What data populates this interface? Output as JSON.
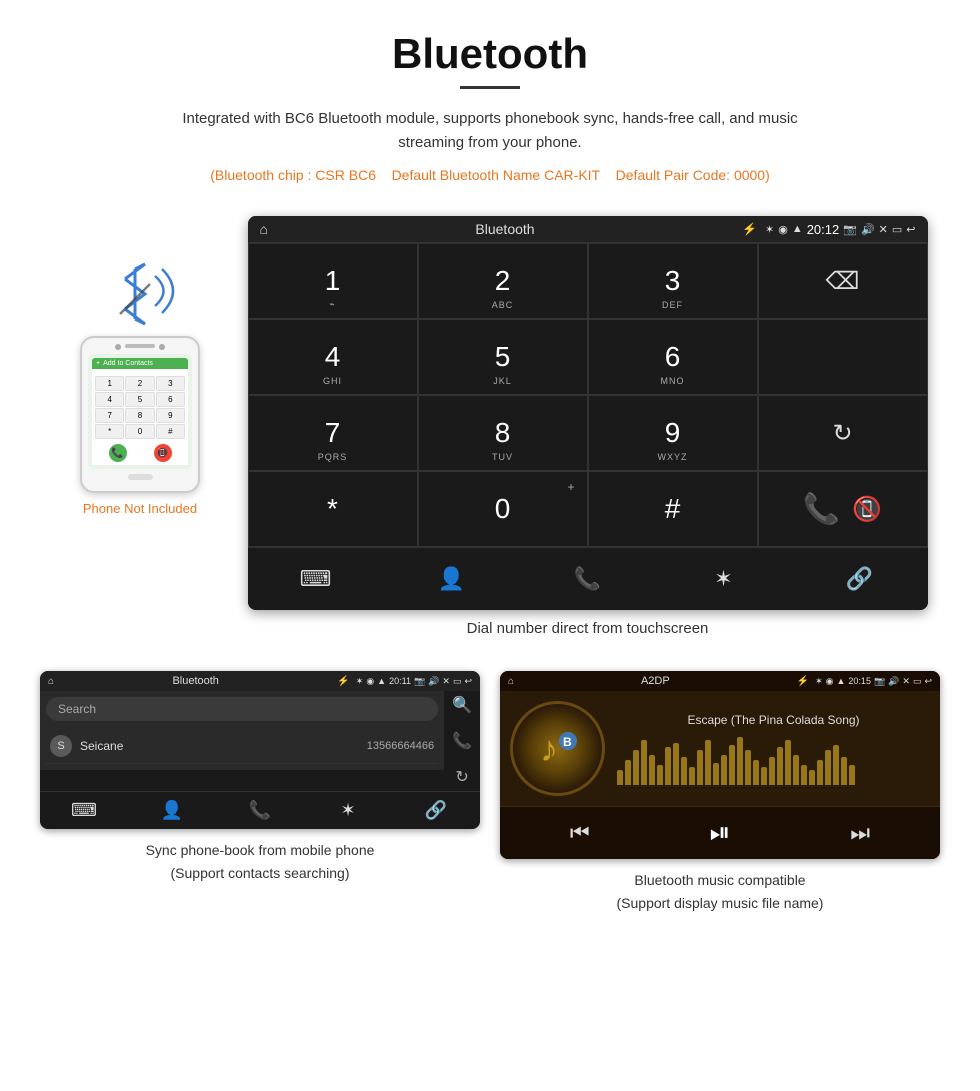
{
  "header": {
    "title": "Bluetooth",
    "description": "Integrated with BC6 Bluetooth module, supports phonebook sync, hands-free call, and music streaming from your phone.",
    "info_line1": "(Bluetooth chip : CSR BC6",
    "info_line2": "Default Bluetooth Name CAR-KIT",
    "info_line3": "Default Pair Code: 0000)",
    "phone_not_included": "Phone Not Included"
  },
  "dialer_screen": {
    "title": "Bluetooth",
    "time": "20:12",
    "keys": [
      {
        "num": "1",
        "sub": ""
      },
      {
        "num": "2",
        "sub": "ABC"
      },
      {
        "num": "3",
        "sub": "DEF"
      },
      {
        "num": "4",
        "sub": "GHI"
      },
      {
        "num": "5",
        "sub": "JKL"
      },
      {
        "num": "6",
        "sub": "MNO"
      },
      {
        "num": "7",
        "sub": "PQRS"
      },
      {
        "num": "8",
        "sub": "TUV"
      },
      {
        "num": "9",
        "sub": "WXYZ"
      },
      {
        "num": "*",
        "sub": ""
      },
      {
        "num": "0",
        "sub": "+"
      },
      {
        "num": "#",
        "sub": ""
      }
    ],
    "caption": "Dial number direct from touchscreen"
  },
  "phonebook_screen": {
    "title": "Bluetooth",
    "time": "20:11",
    "search_placeholder": "Search",
    "contact_initial": "S",
    "contact_name": "Seicane",
    "contact_number": "13566664466",
    "caption_line1": "Sync phone-book from mobile phone",
    "caption_line2": "(Support contacts searching)"
  },
  "music_screen": {
    "title": "A2DP",
    "time": "20:15",
    "track_name": "Escape (The Pina Colada Song)",
    "wave_heights": [
      15,
      25,
      35,
      45,
      30,
      20,
      38,
      42,
      28,
      18,
      35,
      45,
      22,
      30,
      40,
      48,
      35,
      25,
      18,
      28,
      38,
      45,
      30,
      20,
      15,
      25,
      35,
      40,
      28,
      20
    ],
    "caption_line1": "Bluetooth music compatible",
    "caption_line2": "(Support display music file name)"
  },
  "icons": {
    "home": "⌂",
    "back": "↩",
    "bluetooth": "✶",
    "phone_call": "📞",
    "end_call": "📵",
    "contacts": "👤",
    "dialer": "⌨",
    "search": "🔍",
    "reload": "↻",
    "backspace": "⌫",
    "link": "🔗",
    "prev": "⏮",
    "play_pause": "⏯",
    "next": "⏭",
    "usb": "⚡",
    "camera": "📷",
    "volume": "🔊",
    "close": "✕",
    "window": "▭",
    "signal": "▲",
    "wifi": "▲",
    "battery": "▮",
    "location": "●"
  },
  "colors": {
    "orange": "#e87722",
    "green": "#4caf50",
    "red": "#f44336",
    "blue": "#3a7fd5",
    "dark_bg": "#1a1a1a",
    "medium_bg": "#222222",
    "gold": "#c8a020"
  }
}
